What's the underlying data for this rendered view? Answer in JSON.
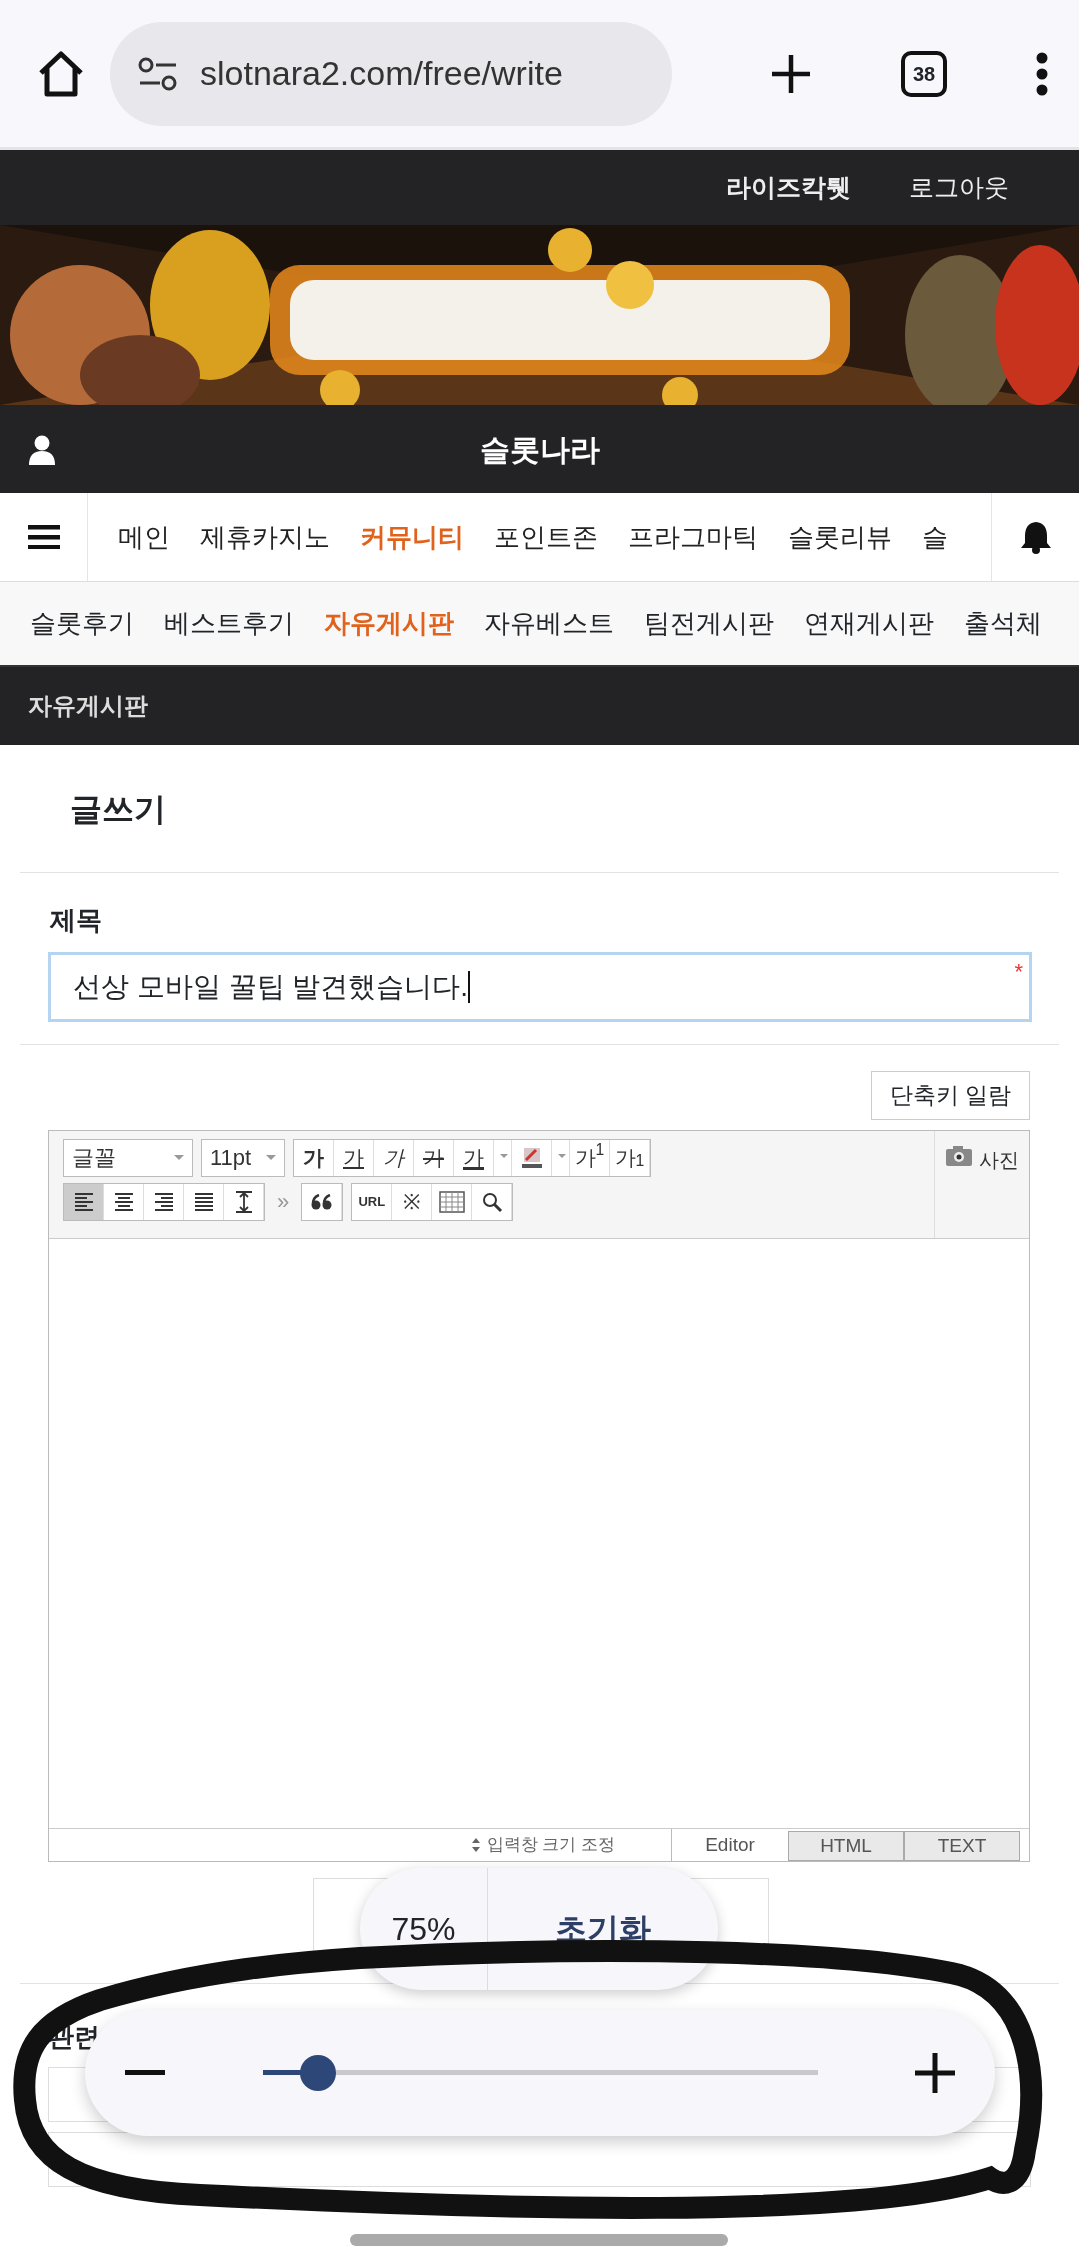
{
  "browser": {
    "url": "slotnara2.com/free/write",
    "tab_count": "38"
  },
  "top_links": [
    {
      "label": "라이즈칵퉷",
      "emphasis": true
    },
    {
      "label": "로그아웃",
      "emphasis": false
    }
  ],
  "site_title": "슬롯나라",
  "nav": [
    {
      "label": "메인",
      "selected": false
    },
    {
      "label": "제휴카지노",
      "selected": false
    },
    {
      "label": "커뮤니티",
      "selected": true
    },
    {
      "label": "포인트존",
      "selected": false
    },
    {
      "label": "프라그마틱",
      "selected": false
    },
    {
      "label": "슬롯리뷰",
      "selected": false
    },
    {
      "label": "슬",
      "selected": false
    }
  ],
  "subnav": [
    {
      "label": "슬롯후기",
      "selected": false
    },
    {
      "label": "베스트후기",
      "selected": false
    },
    {
      "label": "자유게시판",
      "selected": true
    },
    {
      "label": "자유베스트",
      "selected": false
    },
    {
      "label": "팀전게시판",
      "selected": false
    },
    {
      "label": "연재게시판",
      "selected": false
    },
    {
      "label": "출석체",
      "selected": false
    }
  ],
  "board_title": "자유게시판",
  "form": {
    "heading": "글쓰기",
    "subject_label": "제목",
    "subject_value": "선상 모바일 꿀팁 발견했습니다.",
    "required_mark": "*",
    "shortcut_button": "단축키 일람"
  },
  "editor": {
    "font_select": "글꼴",
    "size_select": "11pt",
    "format_buttons": [
      {
        "kind": "bold",
        "label": "가"
      },
      {
        "kind": "underline",
        "label": "가"
      },
      {
        "kind": "italic",
        "label": "가"
      },
      {
        "kind": "strike",
        "label": "가"
      },
      {
        "kind": "color",
        "label": "가"
      },
      {
        "kind": "highlight"
      },
      {
        "kind": "superscript",
        "label": "가$^{1}$"
      },
      {
        "kind": "subscript",
        "label": "가$_{1}$"
      }
    ],
    "align_buttons": [
      {
        "kind": "left",
        "selected": true
      },
      {
        "kind": "center",
        "selected": false
      },
      {
        "kind": "right",
        "selected": false
      },
      {
        "kind": "justify",
        "selected": false
      },
      {
        "kind": "line-height",
        "selected": false
      }
    ],
    "more": "»",
    "insert_buttons": [
      {
        "kind": "quote"
      },
      {
        "kind": "url",
        "label": "URL"
      },
      {
        "kind": "symbol",
        "label": "※"
      },
      {
        "kind": "table"
      },
      {
        "kind": "search"
      }
    ],
    "photo_label": "사진",
    "resize_label": "입력창 크기 조정",
    "modes": [
      {
        "label": "Editor",
        "selected": true
      },
      {
        "label": "HTML",
        "selected": false
      },
      {
        "label": "TEXT",
        "selected": false
      }
    ]
  },
  "zoom_popup": {
    "percent": "75%",
    "reset": "초기화"
  },
  "related_heading": "관련",
  "zoom_slider": {
    "level": 0.1
  }
}
